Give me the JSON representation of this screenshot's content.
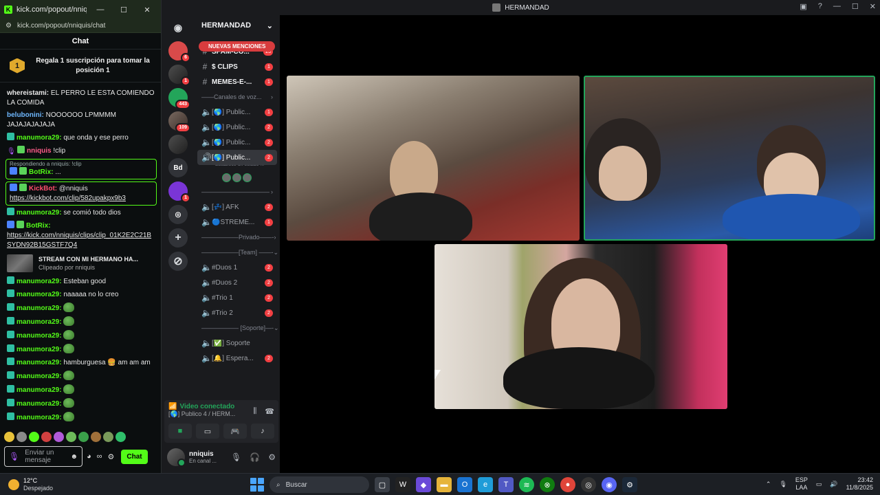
{
  "kick": {
    "window_title": "kick.com/popout/nniquis/chat -...",
    "url": "kick.com/popout/nniquis/chat",
    "chat_header": "Chat",
    "pinned": {
      "rank": "1",
      "text": "Regala 1 suscripción para tomar la posición 1"
    },
    "messages": [
      {
        "user": "whereistami:",
        "text": "EL PERRO LE ESTA COMIENDO LA COMIDA",
        "color": "white"
      },
      {
        "user": "belubonini:",
        "text": "NOOOOOO LPMMMM JAJAJAJAJAJA",
        "color": "blue"
      },
      {
        "user": "manumora29:",
        "text": "que onda y ese perro",
        "color": "green"
      },
      {
        "user": "nniquis",
        "text": "!clip",
        "color": "pink"
      }
    ],
    "reply1": {
      "context": "Respondiendo a nniquis: !clip",
      "user": "BotRix:",
      "text": "..."
    },
    "reply2": {
      "user": "KickBot:",
      "mention": "@nniquis",
      "link": "https://kickbot.com/clip/582upakpx9b3"
    },
    "msg_after": {
      "user": "manumora29:",
      "text": "se comió todo dios"
    },
    "botrix_link": {
      "user": "BotRix:",
      "link": "https://kick.com/nniquis/clips/clip_01K2E2C21BSYDN92B15GSTF7Q4"
    },
    "clip": {
      "title": "STREAM CON MI HERMANO HA...",
      "sub": "Clipeado por nniquis"
    },
    "messages2": [
      {
        "user": "manumora29:",
        "text": "Esteban good"
      },
      {
        "user": "manumora29:",
        "text": "naaaaa no lo creo"
      },
      {
        "user": "manumora29:",
        "text": ""
      },
      {
        "user": "manumora29:",
        "text": ""
      },
      {
        "user": "manumora29:",
        "text": ""
      },
      {
        "user": "manumora29:",
        "text": ""
      },
      {
        "user": "manumora29:",
        "text": "hamburguesa 🍔 am am am"
      },
      {
        "user": "manumora29:",
        "text": ""
      },
      {
        "user": "manumora29:",
        "text": ""
      },
      {
        "user": "manumora29:",
        "text": ""
      },
      {
        "user": "manumora29:",
        "text": ""
      }
    ],
    "input_placeholder": "Enviar un mensaje",
    "chat_button": "Chat"
  },
  "discord": {
    "title": "HERMANDAD",
    "server_name": "HERMANDAD",
    "new_mentions": "NUEVAS MENCIONES",
    "guild_badges": [
      "6",
      "1",
      "443",
      "109",
      "1"
    ],
    "guild_text": "Bd",
    "channels": [
      {
        "name": "SPAM-CO...",
        "count": "25",
        "type": "text"
      },
      {
        "name": "$ CLIPS",
        "count": "1",
        "type": "text"
      },
      {
        "name": "MEMES-E-...",
        "count": "1",
        "type": "text"
      }
    ],
    "cat_voice": "——Canales de voz...",
    "voice": [
      {
        "name": "[🌎] Public...",
        "count": "1"
      },
      {
        "name": "[🌎] Public...",
        "count": "2"
      },
      {
        "name": "[🌎] Public...",
        "count": "2"
      },
      {
        "name": "[🌎] Public...",
        "count": "2"
      }
    ],
    "status_sub": "Establece un estado ...",
    "cat_blank": "———————————",
    "afk": [
      {
        "name": "[💤] AFK",
        "count": "2"
      },
      {
        "name": "🔵STREME...",
        "count": "1"
      }
    ],
    "cat_private": "——————Privado——-",
    "cat_team": "——————[Team] ——-",
    "team": [
      {
        "name": "#Duos 1",
        "count": "2"
      },
      {
        "name": "#Duos 2",
        "count": "2"
      },
      {
        "name": "#Trio 1",
        "count": "2"
      },
      {
        "name": "#Trio 2",
        "count": "2"
      }
    ],
    "cat_support": "—————— [Soporte]—-",
    "support": [
      {
        "name": "[✅] Soporte",
        "count": ""
      },
      {
        "name": "[🔔] Espera...",
        "count": "2"
      }
    ],
    "voice_status": "Video conectado",
    "voice_sub": "[🌎] Publico 4 / HERM...",
    "user": {
      "name": "nniquis",
      "sub": "En canal ..."
    }
  },
  "taskbar": {
    "temp": "12°C",
    "condition": "Despejado",
    "search": "Buscar",
    "lang": "ESP",
    "lang2": "LAA",
    "time": "23:42",
    "date": "11/8/2025"
  }
}
